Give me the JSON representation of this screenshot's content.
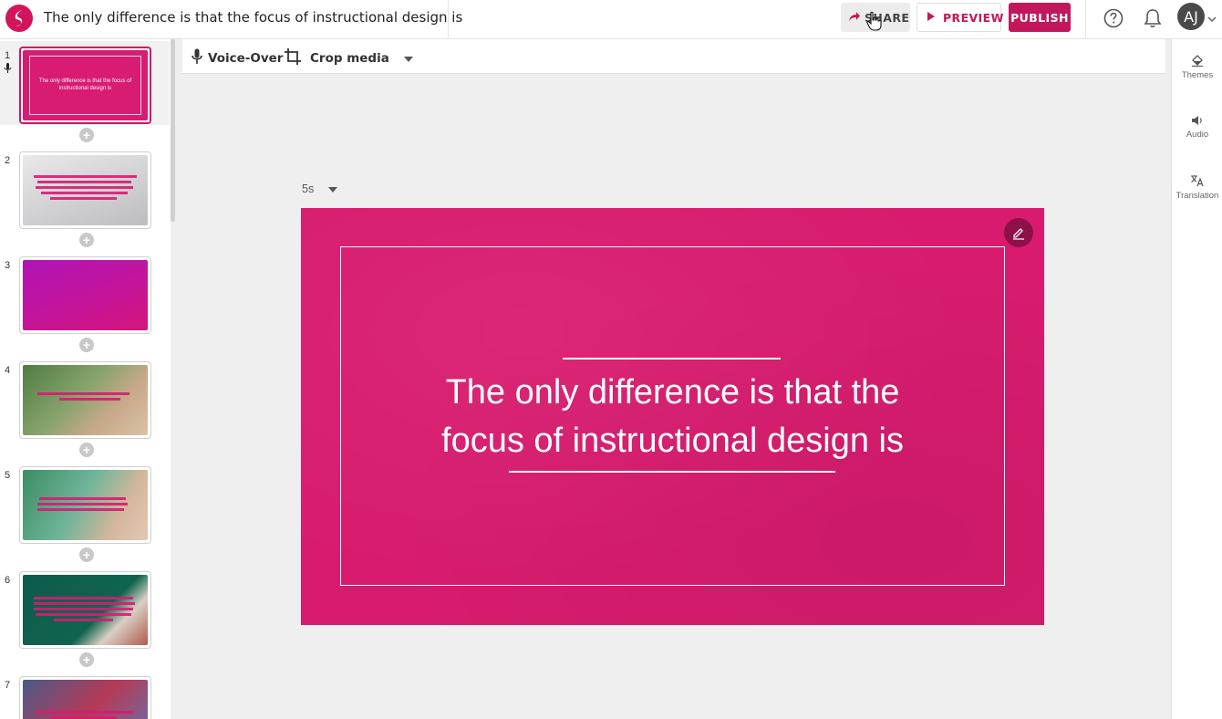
{
  "header": {
    "title": "The only difference is that the focus of instructional design is",
    "share_label": "SHARE",
    "preview_label": "PREVIEW",
    "publish_label": "PUBLISH",
    "avatar_initials": "AJ"
  },
  "toolbar": {
    "voiceover_label": "Voice-Over",
    "crop_label": "Crop media"
  },
  "right_panel": {
    "items": [
      {
        "label": "Themes",
        "icon": "paint-bucket-icon"
      },
      {
        "label": "Audio",
        "icon": "speaker-icon"
      },
      {
        "label": "Translation",
        "icon": "translate-icon"
      }
    ]
  },
  "slides": {
    "numbers": [
      "1",
      "2",
      "3",
      "4",
      "5",
      "6",
      "7"
    ],
    "thumb1_text": "The only difference is that the focus of instructional design is"
  },
  "canvas": {
    "duration": "5s",
    "slide_text": "The only difference is that the focus of instructional design is"
  },
  "colors": {
    "brand": "#c2185b",
    "slide_bg": "#d81b6e"
  }
}
